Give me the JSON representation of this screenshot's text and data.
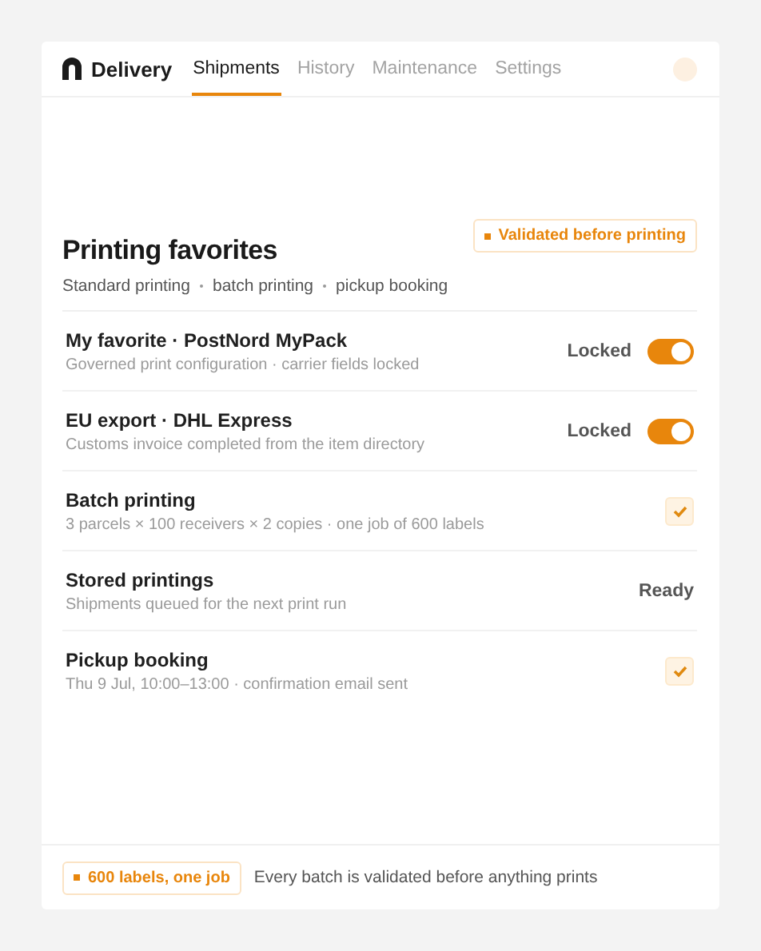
{
  "brand": {
    "name": "Delivery"
  },
  "tabs": [
    {
      "label": "Shipments",
      "selected": true
    },
    {
      "label": "History",
      "selected": false
    },
    {
      "label": "Maintenance",
      "selected": false
    },
    {
      "label": "Settings",
      "selected": false
    }
  ],
  "section": {
    "title": "Printing favorites",
    "badge": "Validated before printing",
    "subtitle_parts": [
      "Standard printing",
      "batch printing",
      "pickup booking"
    ]
  },
  "rows": [
    {
      "kind": "toggle",
      "title": "My favorite · PostNord MyPack",
      "detail": "Governed print configuration · carrier fields locked",
      "status": "Locked",
      "on": true
    },
    {
      "kind": "toggle",
      "title": "EU export · DHL Express",
      "detail": "Customs invoice completed from the item directory",
      "status": "Locked",
      "on": true
    },
    {
      "kind": "check",
      "title": "Batch printing",
      "detail": "3 parcels × 100 receivers × 2 copies · one job of 600 labels",
      "checked": true
    },
    {
      "kind": "status",
      "title": "Stored printings",
      "detail": "Shipments queued for the next print run",
      "status": "Ready"
    },
    {
      "kind": "check",
      "title": "Pickup booking",
      "detail": "Thu 9 Jul, 10:00–13:00 · confirmation email sent",
      "checked": true
    }
  ],
  "footer": {
    "badge": "600 labels, one job",
    "note": "Every batch is validated before anything prints"
  }
}
